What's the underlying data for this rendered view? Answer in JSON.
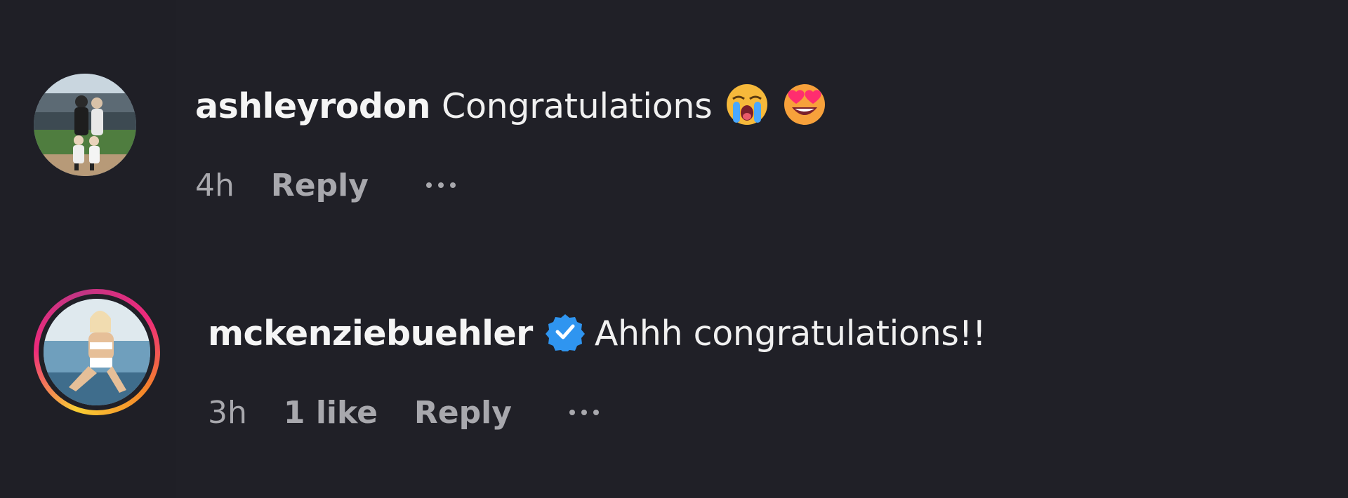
{
  "comments": [
    {
      "username": "ashleyrodon",
      "text": "Congratulations",
      "emojis": [
        "loudly-crying-face-emoji",
        "smiling-face-with-heart-eyes-emoji"
      ],
      "time": "4h",
      "likes": "",
      "reply_label": "Reply",
      "verified": false
    },
    {
      "username": "mckenziebuehler",
      "text": "Ahhh congratulations!!",
      "emojis": [],
      "time": "3h",
      "likes": "1 like",
      "reply_label": "Reply",
      "verified": true
    }
  ],
  "colors": {
    "background": "#202027",
    "text": "#f0f0f0",
    "meta": "#a8a8ad",
    "verified": "#2f95f0"
  }
}
